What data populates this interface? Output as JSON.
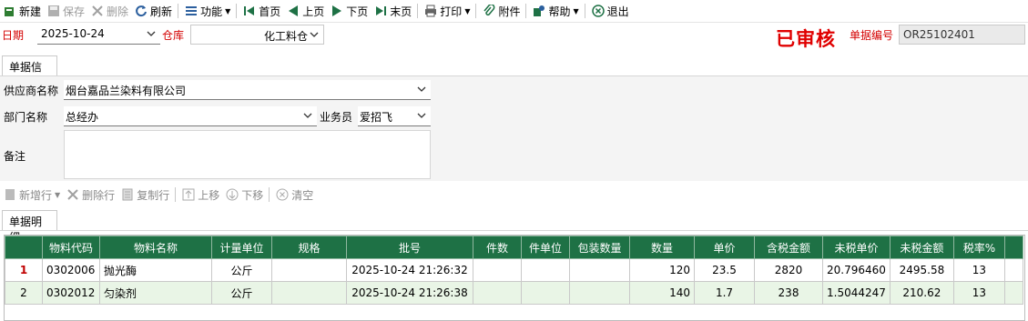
{
  "toolbar": {
    "new": "新建",
    "save": "保存",
    "delete": "删除",
    "refresh": "刷新",
    "function": "功能",
    "first": "首页",
    "prev": "上页",
    "next": "下页",
    "last": "末页",
    "print": "打印",
    "attach": "附件",
    "help": "帮助",
    "exit": "退出"
  },
  "header": {
    "date_label": "日期",
    "date_value": "2025-10-24",
    "warehouse_label": "仓库",
    "warehouse_value": "化工料仓",
    "audit_stamp": "已审核",
    "doc_no_label": "单据编号",
    "doc_no_value": "OR25102401"
  },
  "info_tab": "单据信息",
  "form": {
    "supplier_label": "供应商名称",
    "supplier_value": "烟台嘉品兰染料有限公司",
    "dept_label": "部门名称",
    "dept_value": "总经办",
    "salesman_label": "业务员",
    "salesman_value": "爱招飞",
    "remark_label": "备注",
    "remark_value": ""
  },
  "row_toolbar": {
    "add_row": "新增行",
    "delete_row": "删除行",
    "copy_row": "复制行",
    "move_up": "上移",
    "move_down": "下移",
    "clear": "清空"
  },
  "detail_tab": "单据明细",
  "grid": {
    "columns": [
      "",
      "物料代码",
      "物料名称",
      "计量单位",
      "规格",
      "批号",
      "件数",
      "件单位",
      "包装数量",
      "数量",
      "单价",
      "含税金额",
      "未税单价",
      "未税金额",
      "税率%",
      ""
    ],
    "rows": [
      [
        "1",
        "0302006",
        "抛光酶",
        "公斤",
        "",
        "2025-10-24 21:26:32",
        "",
        "",
        "",
        "120",
        "23.5",
        "2820",
        "20.796460",
        "2495.58",
        "13",
        ""
      ],
      [
        "2",
        "0302012",
        "匀染剂",
        "公斤",
        "",
        "2025-10-24 21:26:38",
        "",
        "",
        "",
        "140",
        "1.7",
        "238",
        "1.5044247",
        "210.62",
        "13",
        ""
      ]
    ]
  },
  "colors": {
    "header_green": "#1e7145",
    "row_alt": "#e9f5e6",
    "label_red": "#d40000",
    "stamp_red": "#e00000"
  }
}
